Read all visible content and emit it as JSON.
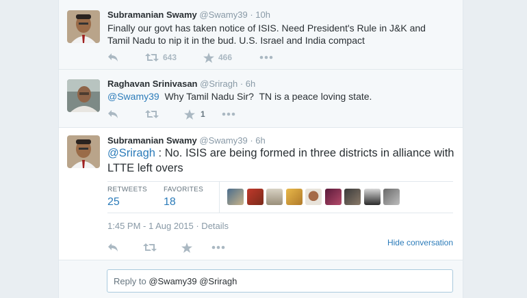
{
  "tweets": [
    {
      "name": "Subramanian Swamy",
      "handle": "@Swamy39",
      "time": "· 10h",
      "text_line1": "Finally our govt has taken notice of ISIS. Need President's Rule in J&K and",
      "text_line2": "Tamil Nadu to nip it in the bud. U.S. Israel and India compact",
      "retweets": "643",
      "favorites": "466"
    },
    {
      "name": "Raghavan Srinivasan",
      "handle": "@Sriragh",
      "time": "· 6h",
      "mention": "@Swamy39",
      "text": "  Why Tamil Nadu Sir?  TN is a peace loving state.",
      "retweets": "",
      "favorites": "1"
    },
    {
      "name": "Subramanian Swamy",
      "handle": "@Swamy39",
      "time": "· 6h",
      "mention": "@Sriragh",
      "text_line1": " : No. ISIS are being formed in three districts in alliance with",
      "text_line2": "LTTE left overs",
      "retweets_label": "RETWEETS",
      "retweets_count": "25",
      "favorites_label": "FAVORITES",
      "favorites_count": "18",
      "datetime": "1:45 PM - 1 Aug 2015 · Details",
      "hide_conversation": "Hide conversation"
    }
  ],
  "reply": {
    "prefix": "Reply to ",
    "mentions": "@Swamy39 @Sriragh"
  },
  "colors": {
    "link": "#2b7bb9",
    "muted": "#8899a6",
    "text": "#292f33",
    "icon": "#aab8c2"
  },
  "icons": [
    "reply-icon",
    "retweet-icon",
    "favorite-star-icon",
    "more-dots-icon"
  ]
}
